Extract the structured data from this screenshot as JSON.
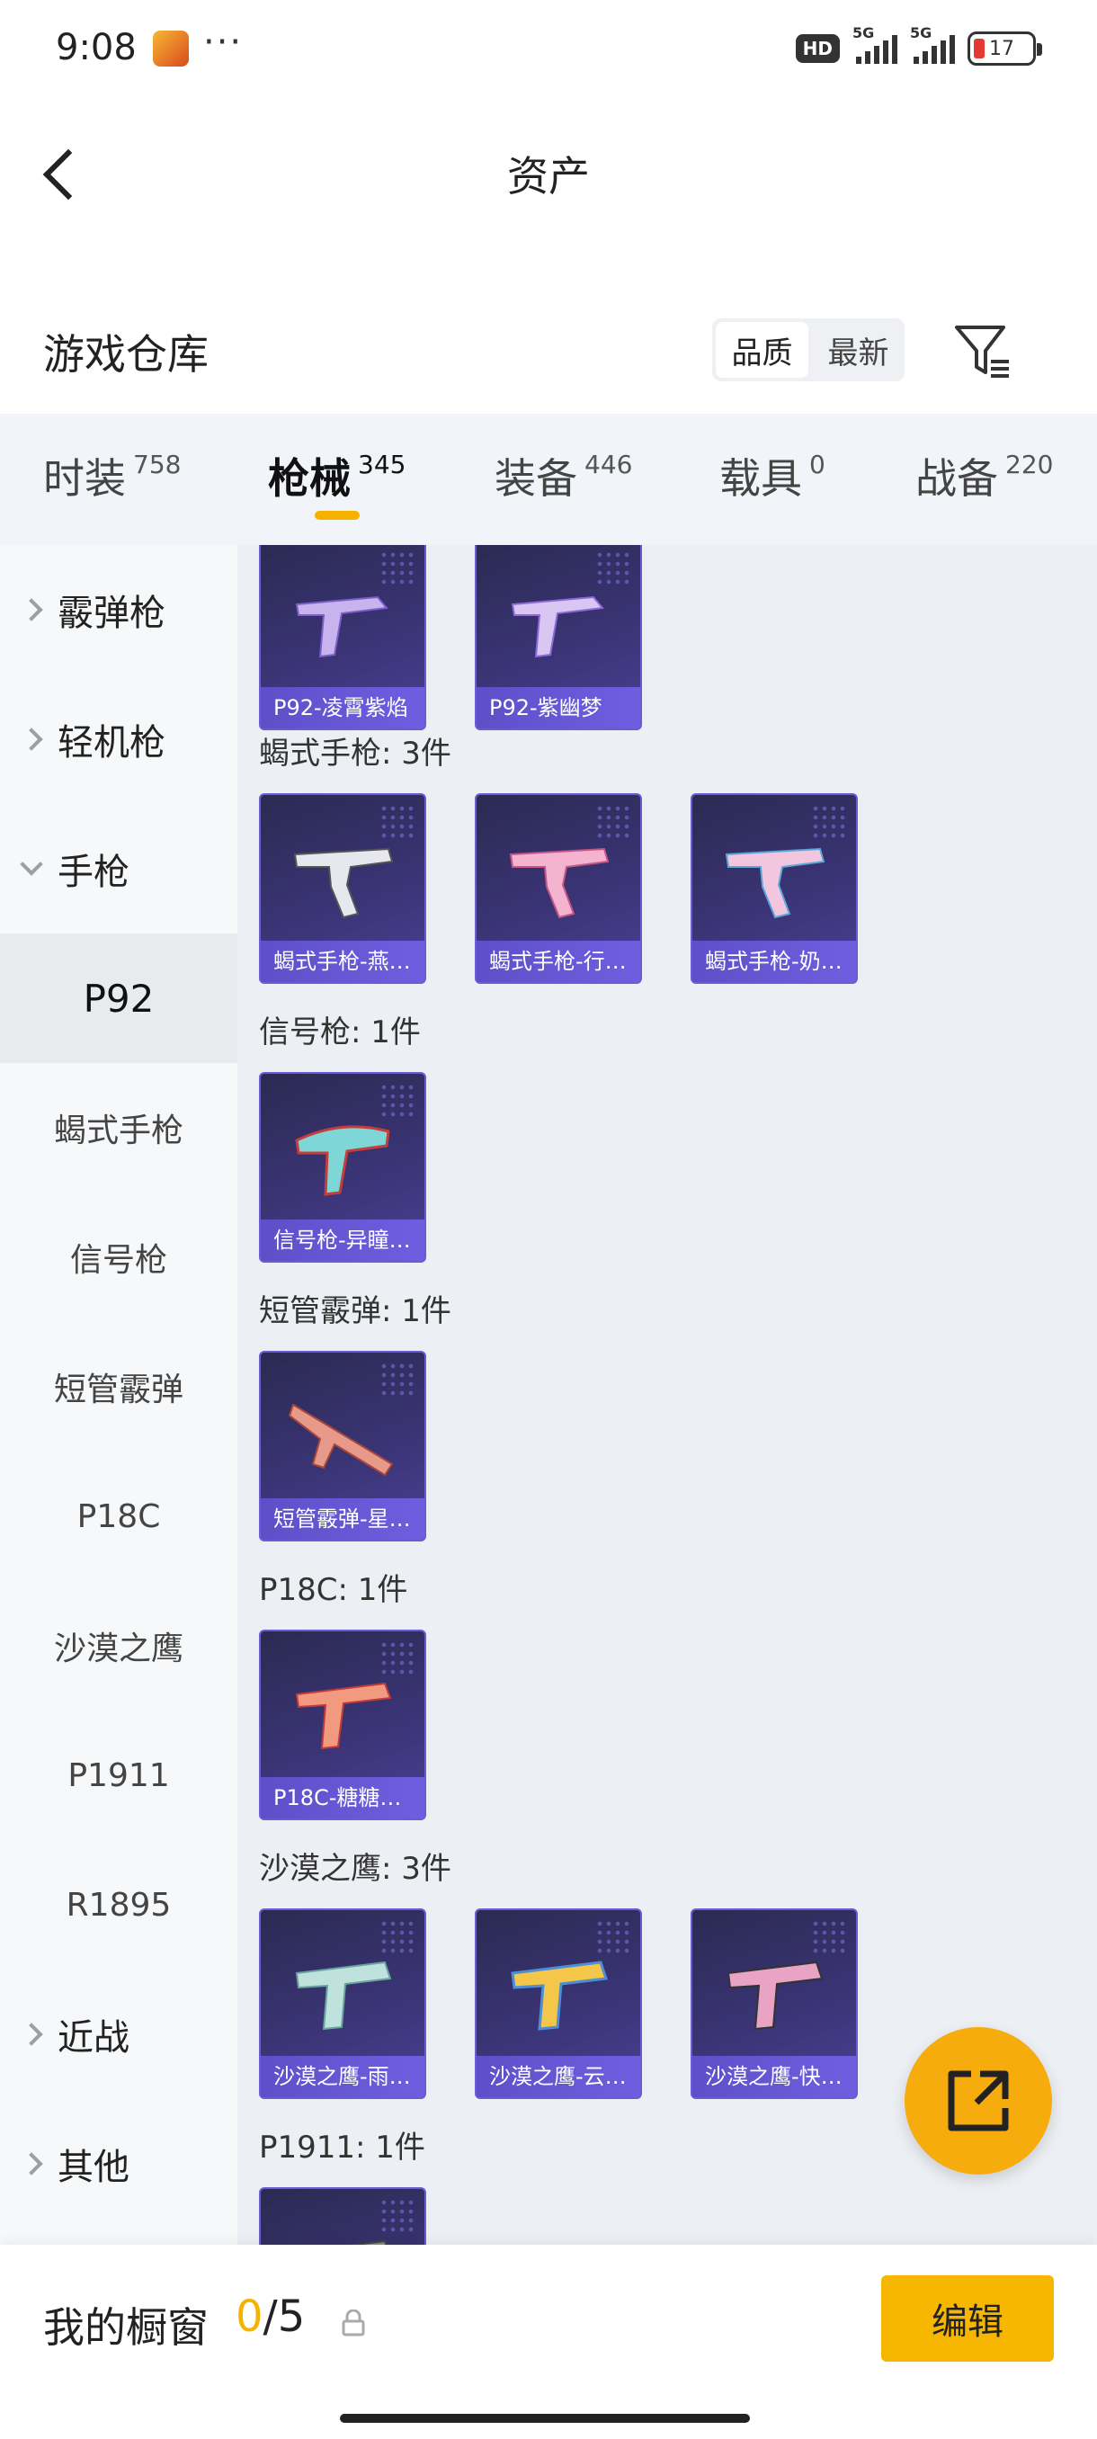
{
  "status_bar": {
    "time": "9:08",
    "more": "···",
    "hd": "HD",
    "network1": "5G",
    "network2": "5G",
    "battery": "17"
  },
  "header": {
    "title": "资产"
  },
  "warehouse": {
    "title": "游戏仓库",
    "sort_options": [
      "品质",
      "最新"
    ],
    "active_sort": "品质"
  },
  "tabs": [
    {
      "label": "时装",
      "count": "758"
    },
    {
      "label": "枪械",
      "count": "345",
      "active": true
    },
    {
      "label": "装备",
      "count": "446"
    },
    {
      "label": "载具",
      "count": "0"
    },
    {
      "label": "战备",
      "count": "220"
    }
  ],
  "sidebar": {
    "groups_top": [
      {
        "label": "霰弹枪"
      },
      {
        "label": "轻机枪"
      },
      {
        "label": "手枪",
        "open": true
      }
    ],
    "sub_items": [
      "P92",
      "蝎式手枪",
      "信号枪",
      "短管霰弹",
      "P18C",
      "沙漠之鹰",
      "P1911",
      "R1895"
    ],
    "active_sub": "P92",
    "groups_bottom": [
      {
        "label": "近战"
      },
      {
        "label": "其他"
      }
    ]
  },
  "content": {
    "sections": [
      {
        "title": "",
        "items": [
          "P92-凌霄紫焰",
          "P92-紫幽梦"
        ]
      },
      {
        "title": "蝎式手枪: 3件",
        "items": [
          "蝎式手枪-燕…",
          "蝎式手枪-行…",
          "蝎式手枪-奶…"
        ]
      },
      {
        "title": "信号枪: 1件",
        "items": [
          "信号枪-异瞳…"
        ]
      },
      {
        "title": "短管霰弹: 1件",
        "items": [
          "短管霰弹-星…"
        ]
      },
      {
        "title": "P18C: 1件",
        "items": [
          "P18C-糖糖…"
        ]
      },
      {
        "title": "沙漠之鹰: 3件",
        "items": [
          "沙漠之鹰-雨…",
          "沙漠之鹰-云…",
          "沙漠之鹰-快…"
        ]
      },
      {
        "title": "P1911: 1件",
        "items": [
          ""
        ]
      }
    ]
  },
  "bottom_bar": {
    "title": "我的橱窗",
    "current": "0",
    "separator": "/",
    "max": "5",
    "edit_label": "编辑"
  },
  "colors": {
    "accent": "#f5b300",
    "card_bg": "#3a3475",
    "card_label": "#6f5fe0",
    "fab": "#f7ac0e"
  }
}
